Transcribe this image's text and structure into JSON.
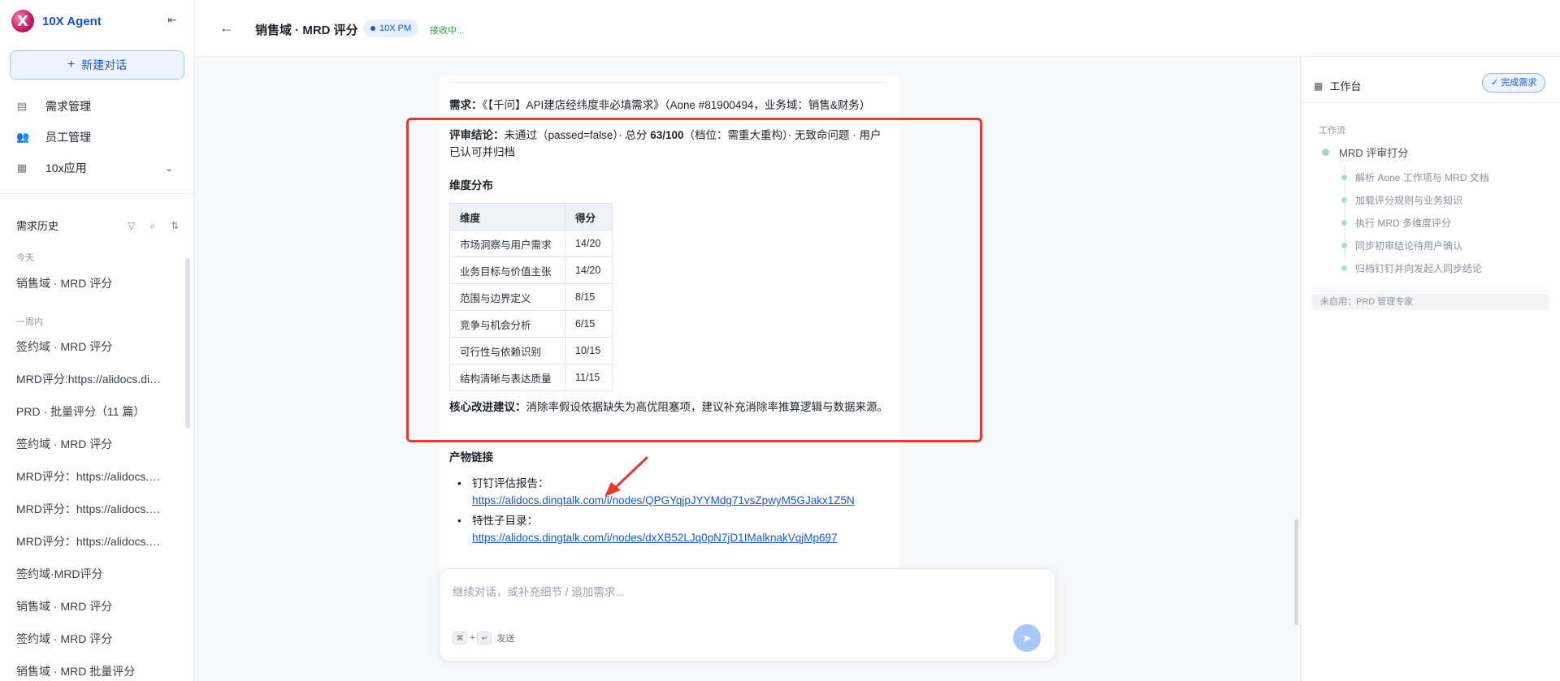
{
  "app": {
    "brand_name": "10X Agent",
    "logo_letter": "X"
  },
  "sidebar": {
    "new_chat_label": "新建对话",
    "nav": [
      {
        "label": "需求管理",
        "icon": "document-icon"
      },
      {
        "label": "员工管理",
        "icon": "users-icon"
      },
      {
        "label": "10x应用",
        "icon": "grid-icon"
      }
    ],
    "history_title": "需求历史",
    "groups": {
      "today": "今天",
      "week": "一周内"
    },
    "today_items": [
      "销售域 · MRD 评分"
    ],
    "week_items": [
      "签约域 · MRD 评分",
      "MRD评分:https://alidocs.dingtalk.com",
      "PRD · 批量评分（11 篇）",
      "签约域 · MRD 评分",
      "MRD评分：https://alidocs.dingtalk.com",
      "MRD评分：https://alidocs.dingtalk.com",
      "MRD评分：https://alidocs.dingtalk.com",
      "签约域·MRD评分",
      "销售域 · MRD 评分",
      "签约域 · MRD 评分",
      "销售域 · MRD 批量评分"
    ]
  },
  "header": {
    "title": "销售域 · MRD 评分",
    "badge": "10X PM",
    "status": "接收中..."
  },
  "message": {
    "demand_label": "需求：",
    "demand_text": "《【千问】API建店经纬度非必填需求》（Aone #81900494，业务域：销售&财务）",
    "verdict_label": "评审结论：",
    "verdict_pre": "未通过（passed=false）· 总分 ",
    "verdict_score": "63/100",
    "verdict_post": "（档位：需重大重构）· 无致命问题 · 用户已认可并归档",
    "dist_title": "维度分布",
    "table": {
      "headers": [
        "维度",
        "得分"
      ],
      "rows": [
        [
          "市场洞察与用户需求",
          "14/20"
        ],
        [
          "业务目标与价值主张",
          "14/20"
        ],
        [
          "范围与边界定义",
          "8/15"
        ],
        [
          "竞争与机会分析",
          "6/15"
        ],
        [
          "可行性与依赖识别",
          "10/15"
        ],
        [
          "结构清晰与表达质量",
          "11/15"
        ]
      ]
    },
    "advice_label": "核心改进建议：",
    "advice_text": "消除率假设依据缺失为高优阻塞项，建议补充消除率推算逻辑与数据来源。",
    "artifacts_title": "产物链接",
    "links": [
      {
        "label": "钉钉评估报告：",
        "url": "https://alidocs.dingtalk.com/i/nodes/QPGYqjpJYYMdg71vsZpwyM5GJakx1Z5N"
      },
      {
        "label": "特性子目录：",
        "url": "https://alidocs.dingtalk.com/i/nodes/dxXB52LJq0pN7jD1IMalknakVqjMp697"
      }
    ]
  },
  "composer": {
    "placeholder": "继续对话，或补充细节 / 追加需求...",
    "shortcut_key1": "⌘",
    "shortcut_plus": "+",
    "shortcut_key2": "↵",
    "shortcut_label": "发送"
  },
  "right_panel": {
    "title": "工作台",
    "done_button": "完成需求",
    "workflow_label": "工作流",
    "workflow_name": "MRD 评审打分",
    "steps": [
      "解析 Aone 工作项与 MRD 文档",
      "加载评分规则与业务知识",
      "执行 MRD 多维度评分",
      "同步初审结论待用户确认",
      "归档钉钉并向发起人同步结论"
    ],
    "inactive": "未启用：PRD 管理专家"
  },
  "colors": {
    "accent": "#1a56db",
    "annotation": "#e53a2f",
    "status_green": "#2ea043"
  }
}
